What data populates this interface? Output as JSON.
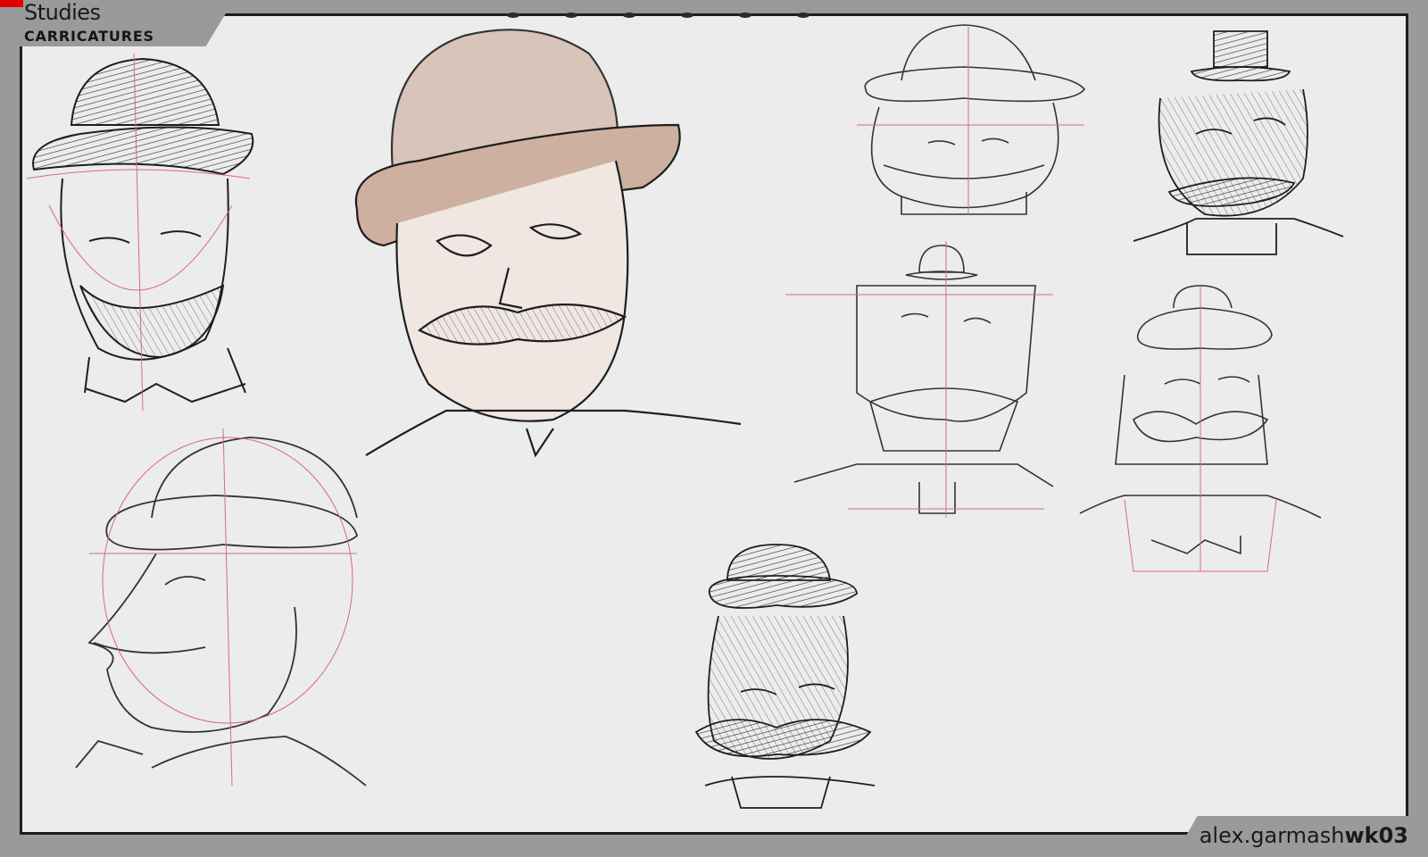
{
  "header": {
    "title": "Studies",
    "subtitle": "CARRICATURES"
  },
  "footer": {
    "author": "alex.garmash",
    "week": "wk03"
  },
  "colors": {
    "frame": "#9a9a9a",
    "paper": "#ececec",
    "ink": "#1e1e1e",
    "construction_lines": "#d86a7a",
    "wash": "#c9ab9b",
    "accent": "#e00000"
  },
  "sketches": [
    {
      "id": "bowler-hat-bearded-man",
      "hat": "bowler",
      "style": "ink hatching"
    },
    {
      "id": "top-hat-mustache-man-toned",
      "hat": "top hat",
      "style": "ink with sepia wash"
    },
    {
      "id": "small-hat-outline-man",
      "hat": "bowler",
      "style": "line sketch"
    },
    {
      "id": "tiny-top-hat-man",
      "hat": "top hat",
      "style": "ink hatching"
    },
    {
      "id": "profile-smiling-man",
      "hat": "bowler",
      "style": "construction sketch"
    },
    {
      "id": "square-head-tiny-bowler",
      "hat": "mini bowler",
      "style": "line sketch"
    },
    {
      "id": "round-hat-mustache-man",
      "hat": "round cap",
      "style": "line sketch"
    },
    {
      "id": "bowler-hat-squint-man",
      "hat": "bowler",
      "style": "ink hatching"
    }
  ]
}
